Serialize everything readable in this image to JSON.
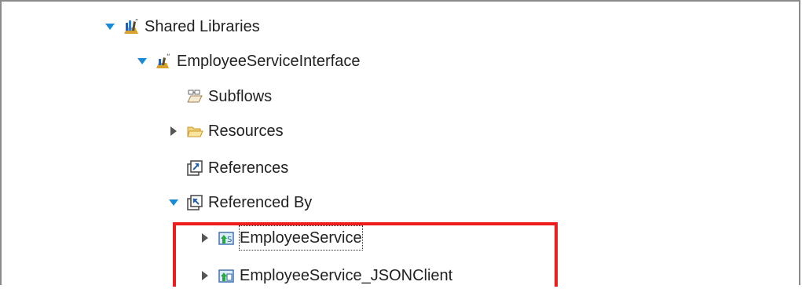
{
  "tree": {
    "items": [
      {
        "label": "Shared Libraries",
        "icon": "shared-libraries-icon",
        "state": "expanded"
      },
      {
        "label": "EmployeeServiceInterface",
        "icon": "shared-library-project-icon",
        "state": "expanded"
      },
      {
        "label": "Subflows",
        "icon": "subflows-icon",
        "state": "leaf"
      },
      {
        "label": "Resources",
        "icon": "folder-icon",
        "state": "collapsed"
      },
      {
        "label": "References",
        "icon": "references-icon",
        "state": "leaf"
      },
      {
        "label": "Referenced By",
        "icon": "referenced-by-icon",
        "state": "expanded"
      },
      {
        "label": "EmployeeService",
        "icon": "rest-api-project-icon",
        "state": "collapsed",
        "focused": true
      },
      {
        "label": "EmployeeService_JSONClient",
        "icon": "application-project-icon",
        "state": "collapsed"
      }
    ]
  },
  "colors": {
    "highlight_border": "#ee1c1c",
    "expanded_arrow": "#1a8ad4",
    "collapsed_arrow": "#555555"
  }
}
